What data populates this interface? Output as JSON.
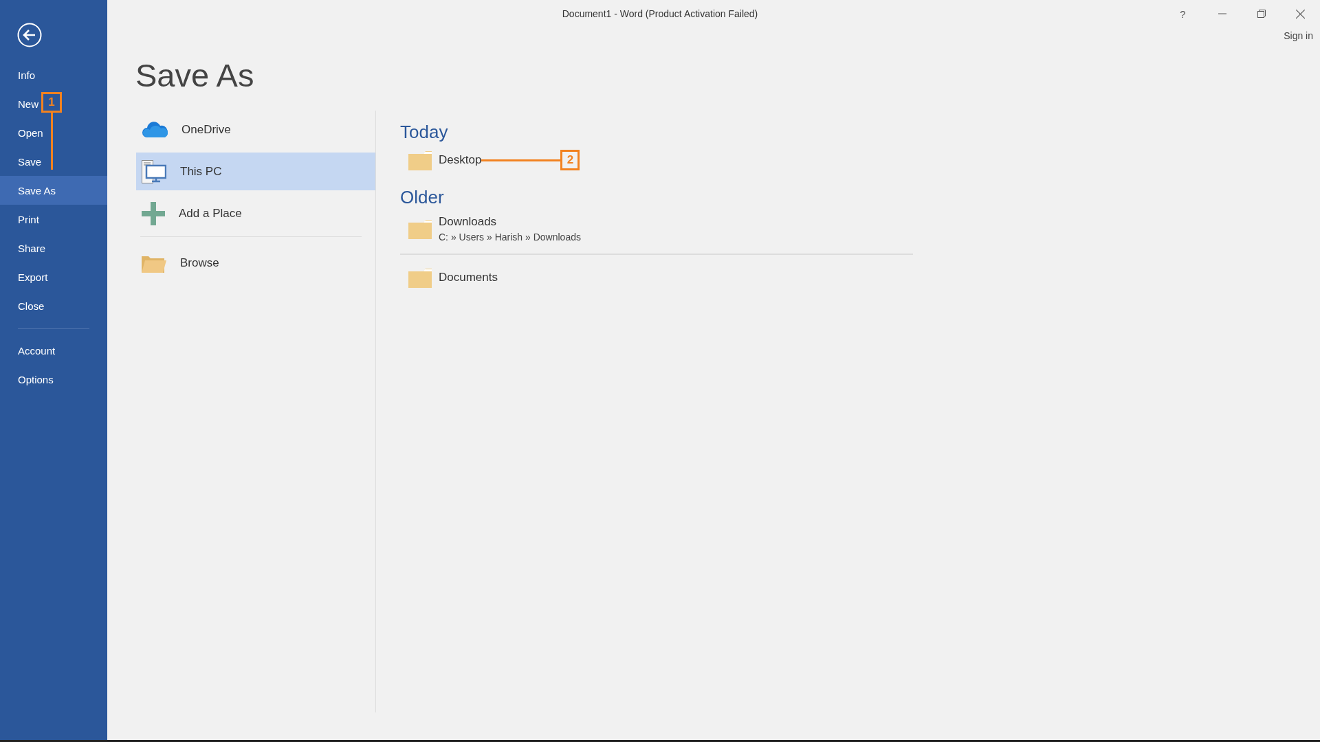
{
  "window": {
    "title": "Document1 - Word (Product Activation Failed)",
    "help": "?",
    "sign_in": "Sign in"
  },
  "sidebar": {
    "items": [
      {
        "label": "Info",
        "selected": false
      },
      {
        "label": "New",
        "selected": false,
        "callout": "1"
      },
      {
        "label": "Open",
        "selected": false
      },
      {
        "label": "Save",
        "selected": false
      },
      {
        "label": "Save As",
        "selected": true
      },
      {
        "label": "Print",
        "selected": false
      },
      {
        "label": "Share",
        "selected": false
      },
      {
        "label": "Export",
        "selected": false
      },
      {
        "label": "Close",
        "selected": false
      }
    ],
    "bottom_items": [
      {
        "label": "Account",
        "selected": false
      },
      {
        "label": "Options",
        "selected": false
      }
    ]
  },
  "page_title": "Save As",
  "places": [
    {
      "label": "OneDrive",
      "kind": "cloud",
      "selected": false
    },
    {
      "label": "This PC",
      "kind": "pc",
      "selected": true
    },
    {
      "label": "Add a Place",
      "kind": "add",
      "selected": false
    },
    {
      "label": "Browse",
      "kind": "browse",
      "selected": false
    }
  ],
  "groups": [
    {
      "heading": "Today",
      "folders": [
        {
          "name": "Desktop",
          "callout": "2"
        }
      ]
    },
    {
      "heading": "Older",
      "folders": [
        {
          "name": "Downloads",
          "path": "C: » Users » Harish » Downloads"
        },
        {
          "name": "Documents"
        }
      ]
    }
  ]
}
